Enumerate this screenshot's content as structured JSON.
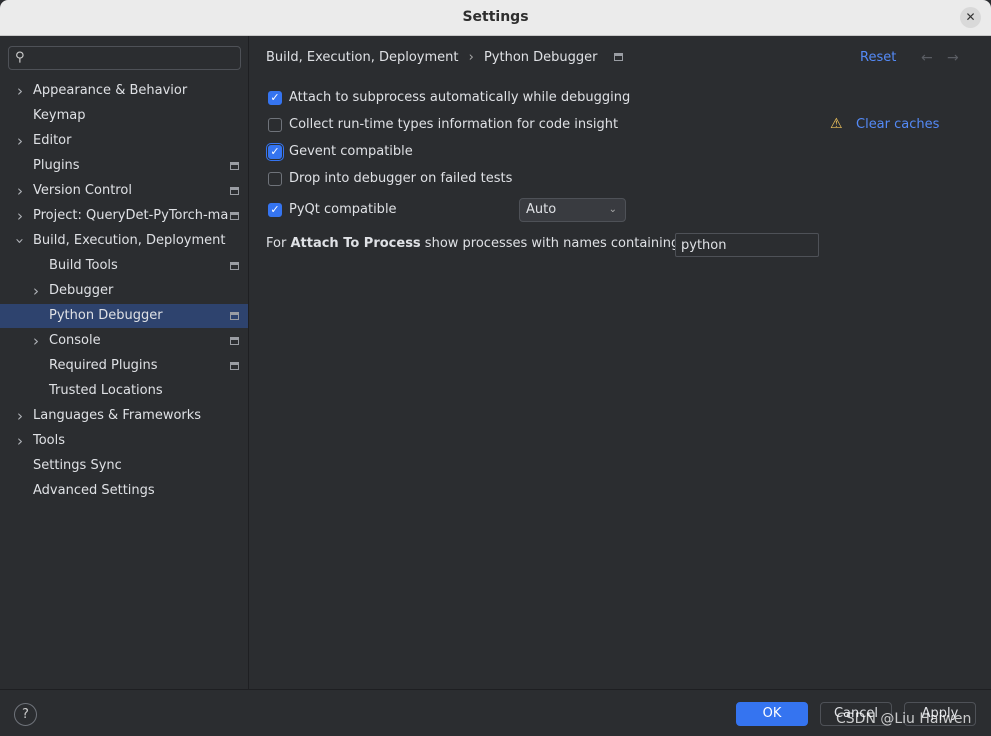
{
  "window": {
    "title": "Settings"
  },
  "sidebar": {
    "search_placeholder": "",
    "items": [
      {
        "label": "Appearance & Behavior",
        "level": 1,
        "chevron": true,
        "icon": false
      },
      {
        "label": "Keymap",
        "level": 1,
        "chevron": false,
        "icon": false
      },
      {
        "label": "Editor",
        "level": 1,
        "chevron": true,
        "icon": false
      },
      {
        "label": "Plugins",
        "level": 1,
        "chevron": false,
        "icon": true
      },
      {
        "label": "Version Control",
        "level": 1,
        "chevron": true,
        "icon": true
      },
      {
        "label": "Project: QueryDet-PyTorch-ma",
        "level": 1,
        "chevron": true,
        "icon": true
      },
      {
        "label": "Build, Execution, Deployment",
        "level": 1,
        "chevron": "open",
        "icon": false
      },
      {
        "label": "Build Tools",
        "level": 2,
        "chevron": false,
        "icon": true
      },
      {
        "label": "Debugger",
        "level": 2,
        "chevron": true,
        "icon": false
      },
      {
        "label": "Python Debugger",
        "level": 2,
        "chevron": false,
        "icon": true,
        "selected": true
      },
      {
        "label": "Console",
        "level": 2,
        "chevron": true,
        "icon": true
      },
      {
        "label": "Required Plugins",
        "level": 2,
        "chevron": false,
        "icon": true
      },
      {
        "label": "Trusted Locations",
        "level": 2,
        "chevron": false,
        "icon": false
      },
      {
        "label": "Languages & Frameworks",
        "level": 1,
        "chevron": true,
        "icon": false
      },
      {
        "label": "Tools",
        "level": 1,
        "chevron": true,
        "icon": false
      },
      {
        "label": "Settings Sync",
        "level": 1,
        "chevron": false,
        "icon": false
      },
      {
        "label": "Advanced Settings",
        "level": 1,
        "chevron": false,
        "icon": false
      }
    ]
  },
  "main": {
    "breadcrumb": [
      "Build, Execution, Deployment",
      "Python Debugger"
    ],
    "reset": "Reset",
    "options": [
      {
        "label": "Attach to subprocess automatically while debugging",
        "checked": true
      },
      {
        "label": "Collect run-time types information for code insight",
        "checked": false
      },
      {
        "label": "Gevent compatible",
        "checked": true,
        "focused": true
      },
      {
        "label": "Drop into debugger on failed tests",
        "checked": false
      },
      {
        "label": "PyQt compatible",
        "checked": true
      }
    ],
    "clear_caches": "Clear caches",
    "pyqt_mode": "Auto",
    "attach": {
      "prefix": "For ",
      "bold": "Attach To Process",
      "suffix": " show processes with names containing:",
      "value": "python"
    }
  },
  "footer": {
    "help": "?",
    "ok": "OK",
    "cancel": "Cancel",
    "apply": "Apply"
  },
  "watermark": "CSDN @Liu Haiwen",
  "colors": {
    "accent": "#3574f0",
    "link": "#548af7",
    "selection": "#2e436e",
    "warning": "#f2c55c"
  }
}
